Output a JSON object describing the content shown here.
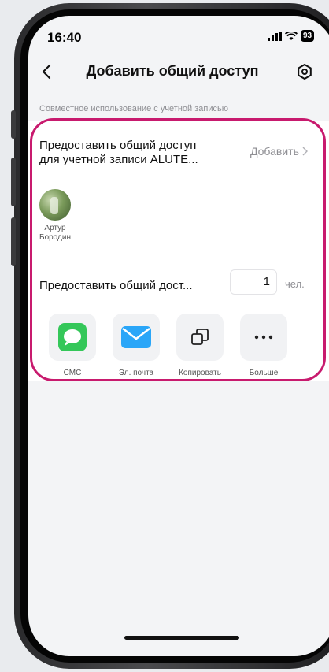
{
  "status_bar": {
    "time": "16:40",
    "battery": "93"
  },
  "nav": {
    "title": "Добавить общий доступ"
  },
  "section": {
    "caption": "Совместное использование с учетной записью"
  },
  "account_share": {
    "title_line1": "Предоставить общий доступ",
    "title_line2": "для учетной записи ALUTE...",
    "add_label": "Добавить"
  },
  "shared_users": [
    {
      "name_line1": "Артур",
      "name_line2": "Бородин"
    }
  ],
  "count_share": {
    "label": "Предоставить общий дост...",
    "value": "1",
    "unit": "чел."
  },
  "share_options": [
    {
      "label": "СМС",
      "icon": "message-icon"
    },
    {
      "label": "Эл. почта",
      "icon": "mail-icon"
    },
    {
      "label": "Копировать",
      "icon": "copy-icon"
    },
    {
      "label": "Больше",
      "icon": "more-icon"
    }
  ],
  "colors": {
    "highlight": "#c81a6e",
    "sms": "#34c759",
    "mail": "#2aa6f8"
  }
}
